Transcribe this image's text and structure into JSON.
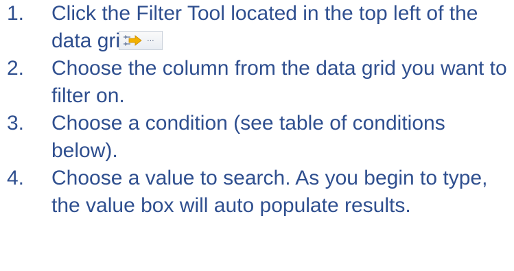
{
  "steps": [
    {
      "number": "1.",
      "text_before": "Click the Filter Tool located in the top left of the data gri",
      "text_after": ""
    },
    {
      "number": "2.",
      "text": "Choose the column from the data grid you want to filter on."
    },
    {
      "number": "3.",
      "text": "Choose a condition (see table of conditions below)."
    },
    {
      "number": "4.",
      "text": "Choose a value to search. As you begin to type, the value box will auto populate results."
    }
  ],
  "filter_tool": {
    "icon": "filter-arrow-icon",
    "ellipsis": "..."
  },
  "colors": {
    "text": "#2f4f8f",
    "arrow": "#f2b100",
    "background": "#ffffff"
  }
}
